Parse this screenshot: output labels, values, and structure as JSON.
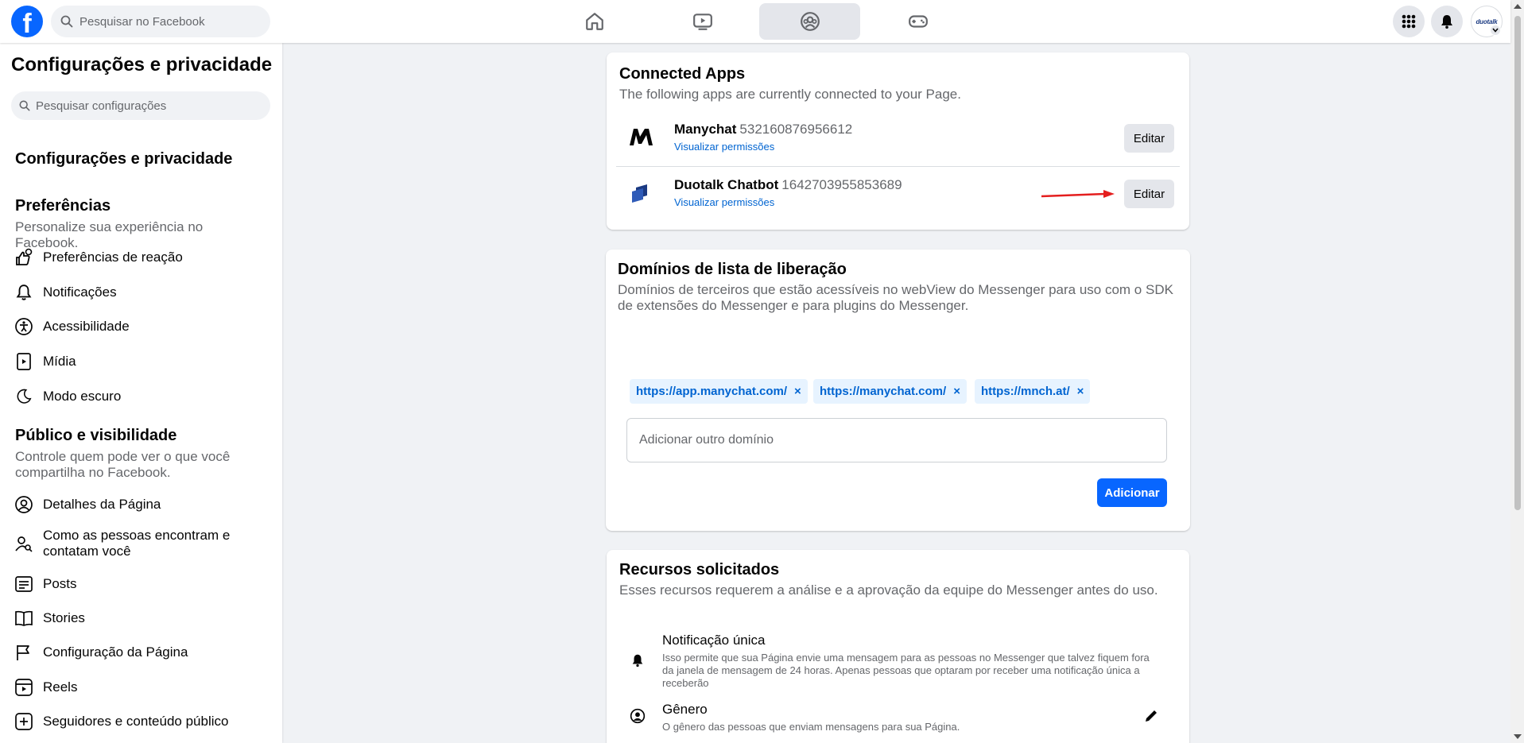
{
  "topbar": {
    "logo": "f",
    "search_placeholder": "Pesquisar no Facebook",
    "nav_icons": [
      "home-icon",
      "video-icon",
      "groups-icon",
      "gaming-icon"
    ],
    "active_nav": "groups-icon",
    "right_icons": [
      "menu-grid-icon",
      "bell-icon"
    ],
    "avatar_text": "duotalk"
  },
  "sidebar": {
    "title": "Configurações e privacidade",
    "search_placeholder": "Pesquisar configurações",
    "section_title": "Configurações e privacidade",
    "preferences": {
      "heading": "Preferências",
      "subtitle": "Personalize sua experiência no Facebook.",
      "items": [
        {
          "label": "Preferências de reação",
          "icon": "reaction-icon"
        },
        {
          "label": "Notificações",
          "icon": "bell-icon"
        },
        {
          "label": "Acessibilidade",
          "icon": "accessibility-icon"
        },
        {
          "label": "Mídia",
          "icon": "media-icon"
        },
        {
          "label": "Modo escuro",
          "icon": "moon-icon"
        }
      ]
    },
    "audience": {
      "heading": "Público e visibilidade",
      "subtitle": "Controle quem pode ver o que você compartilha no Facebook.",
      "items": [
        {
          "label": "Detalhes da Página",
          "icon": "user-circle-icon"
        },
        {
          "label": "Como as pessoas encontram e contatam você",
          "icon": "user-search-icon"
        },
        {
          "label": "Posts",
          "icon": "posts-icon"
        },
        {
          "label": "Stories",
          "icon": "stories-icon"
        },
        {
          "label": "Configuração da Página",
          "icon": "flag-icon"
        },
        {
          "label": "Reels",
          "icon": "reels-icon"
        },
        {
          "label": "Seguidores e conteúdo público",
          "icon": "plus-square-icon"
        }
      ]
    }
  },
  "connected_apps": {
    "title": "Connected Apps",
    "subtitle": "The following apps are currently connected to your Page.",
    "apps": [
      {
        "name": "Manychat",
        "id": "532160876956612",
        "link": "Visualizar permissões",
        "button": "Editar"
      },
      {
        "name": "Duotalk Chatbot",
        "id": "1642703955853689",
        "link": "Visualizar permissões",
        "button": "Editar"
      }
    ]
  },
  "whitelist": {
    "title": "Domínios de lista de liberação",
    "subtitle": "Domínios de terceiros que estão acessíveis no webView do Messenger para uso com o SDK de extensões do Messenger e para plugins do Messenger.",
    "domains": [
      "https://app.manychat.com/",
      "https://manychat.com/",
      "https://mnch.at/"
    ],
    "input_placeholder": "Adicionar outro domínio",
    "add_button": "Adicionar"
  },
  "requested": {
    "title": "Recursos solicitados",
    "subtitle": "Esses recursos requerem a análise e a aprovação da equipe do Messenger antes do uso.",
    "items": [
      {
        "title": "Notificação única",
        "desc": "Isso permite que sua Página envie uma mensagem para as pessoas no Messenger que talvez fiquem fora da janela de mensagem de 24 horas. Apenas pessoas que optaram por receber uma notificação única a receberão",
        "icon": "bell-icon"
      },
      {
        "title": "Gênero",
        "desc": "O gênero das pessoas que enviam mensagens para sua Página.",
        "icon": "user-circle-icon"
      }
    ]
  },
  "colors": {
    "brand": "#0866ff",
    "link": "#0064d1",
    "annotation_arrow": "#e41e1e"
  }
}
